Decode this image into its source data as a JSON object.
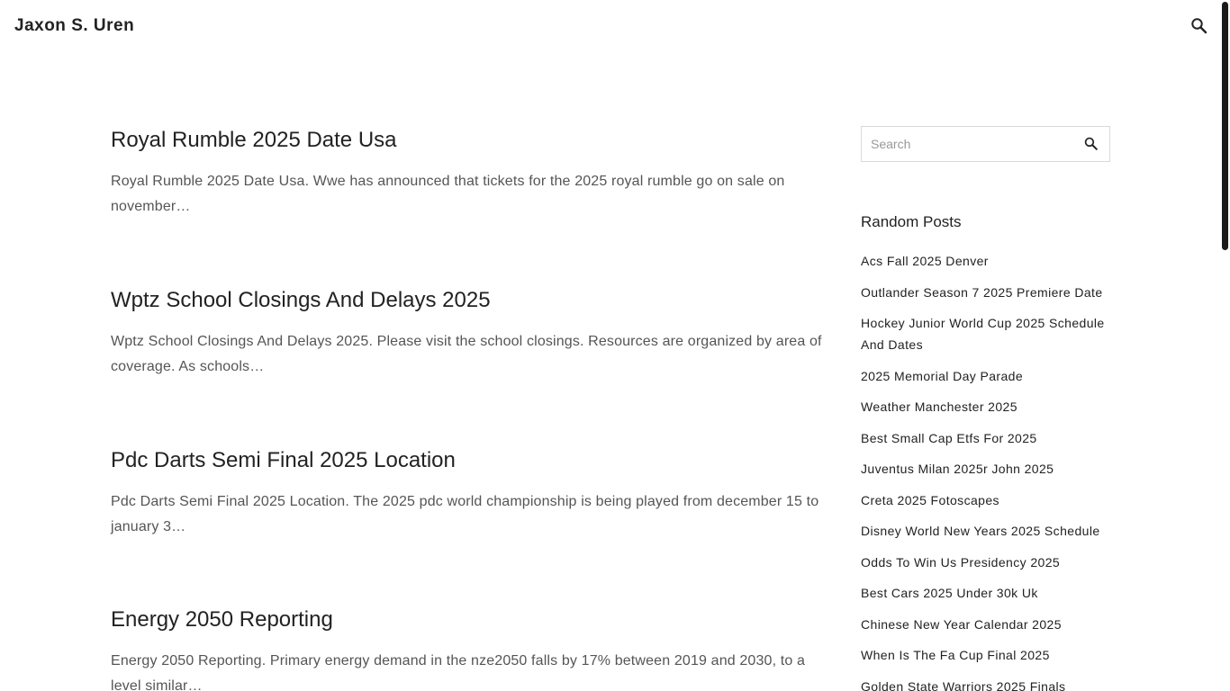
{
  "header": {
    "site_title": "Jaxon S. Uren",
    "search_icon": "search-icon"
  },
  "posts": [
    {
      "title": "Royal Rumble 2025 Date Usa",
      "excerpt": "Royal Rumble 2025 Date Usa. Wwe has announced that tickets for the 2025 royal rumble go on sale on november…"
    },
    {
      "title": "Wptz School Closings And Delays 2025",
      "excerpt": "Wptz School Closings And Delays 2025. Please visit the school closings. Resources are organized by area of coverage. As schools…"
    },
    {
      "title": "Pdc Darts Semi Final 2025 Location",
      "excerpt": "Pdc Darts Semi Final 2025 Location. The 2025 pdc world championship is being played from december 15 to january 3…"
    },
    {
      "title": "Energy 2050 Reporting",
      "excerpt": "Energy 2050 Reporting. Primary energy demand in the nze2050 falls by 17% between 2019 and 2030, to a level similar…"
    }
  ],
  "sidebar": {
    "search": {
      "placeholder": "Search",
      "value": ""
    },
    "random_posts_title": "Random Posts",
    "random_posts": [
      "Acs Fall 2025 Denver",
      "Outlander Season 7 2025 Premiere Date",
      "Hockey Junior World Cup 2025 Schedule And Dates",
      "2025 Memorial Day Parade",
      "Weather Manchester 2025",
      "Best Small Cap Etfs For 2025",
      "Juventus Milan 2025r John 2025",
      "Creta 2025 Fotoscapes",
      "Disney World New Years 2025 Schedule",
      "Odds To Win Us Presidency 2025",
      "Best Cars 2025 Under 30k Uk",
      "Chinese New Year Calendar 2025",
      "When Is The Fa Cup Final 2025",
      "Golden State Warriors 2025 Finals"
    ]
  }
}
